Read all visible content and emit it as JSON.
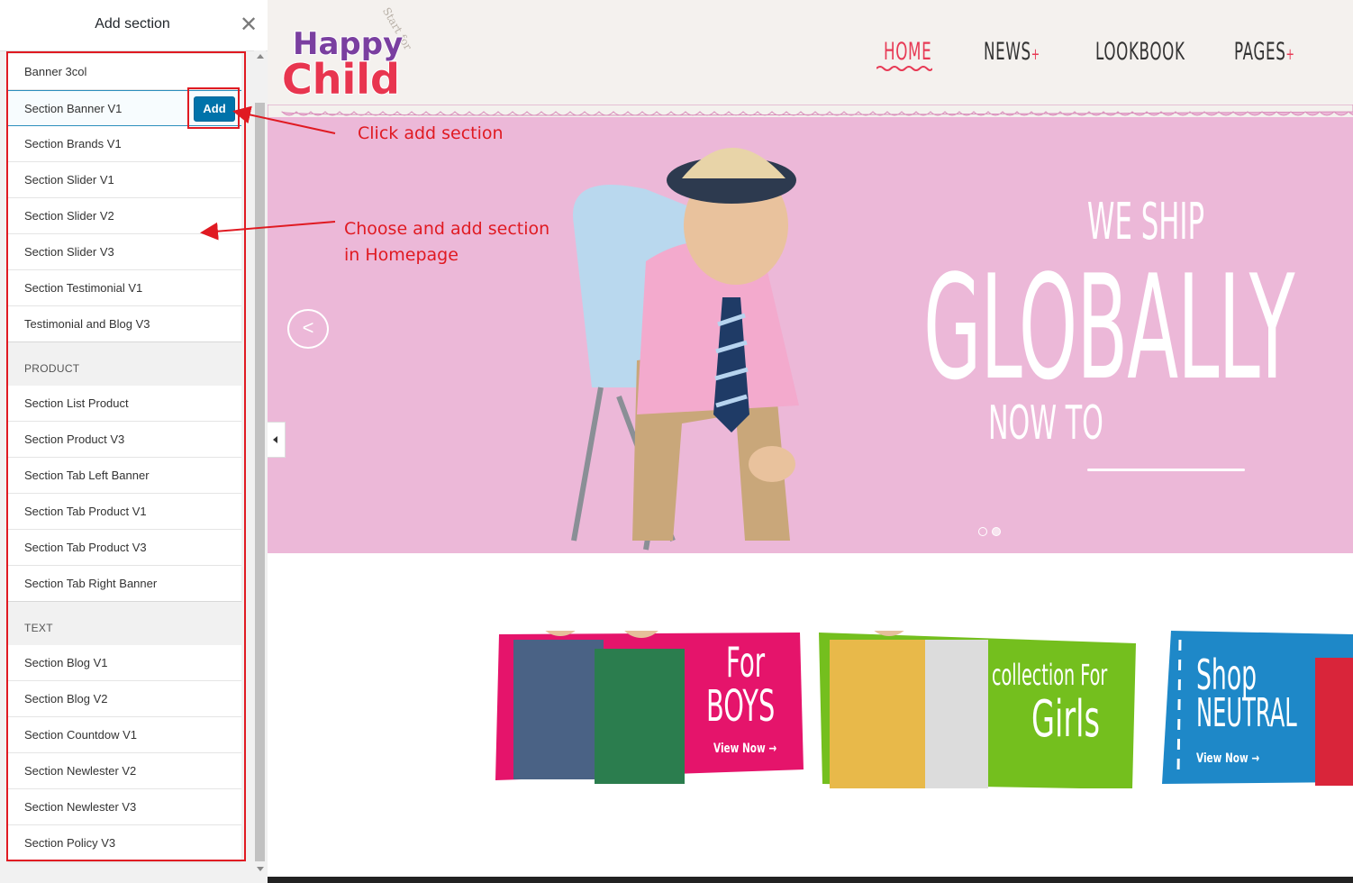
{
  "panel": {
    "title": "Add section",
    "close_icon": "close-icon",
    "add_label": "Add",
    "items_top": [
      "Banner 3col",
      "Section Banner V1",
      "Section Brands V1",
      "Section Slider V1",
      "Section Slider V2",
      "Section Slider V3",
      "Section Testimonial V1",
      "Testimonial and Blog V3"
    ],
    "group_product": "PRODUCT",
    "items_product": [
      "Section List Product",
      "Section Product V3",
      "Section Tab Left Banner",
      "Section Tab Product V1",
      "Section Tab Product V3",
      "Section Tab Right Banner"
    ],
    "group_text": "TEXT",
    "items_text": [
      "Section Blog V1",
      "Section Blog V2",
      "Section Countdow V1",
      "Section Newlester V2",
      "Section Newlester V3",
      "Section Policy V3"
    ]
  },
  "site": {
    "logo": {
      "line1": "Happy",
      "line2": "Child",
      "tagline": "Start for"
    },
    "nav": {
      "home": "HOME",
      "news": "NEWS",
      "lookbook": "LOOKBOOK",
      "pages": "PAGES",
      "plus": "+"
    },
    "banner": {
      "line1": "WE SHIP",
      "line2": "GLOBALLY",
      "line3": "NOW TO",
      "prev": "<",
      "bg": "#ecb8d8"
    },
    "categories": [
      {
        "line1": "For",
        "line2": "BOYS",
        "cta": "View Now",
        "color": "#e5146b"
      },
      {
        "line1": "collection For",
        "line2": "Girls",
        "cta": "",
        "color": "#74bf1e"
      },
      {
        "line1": "Shop",
        "line2": "NEUTRAL",
        "cta": "View Now",
        "color": "#1e88c8"
      }
    ]
  },
  "annotations": {
    "click_add": "Click add section",
    "choose_line1": "Choose and add section",
    "choose_line2": "in Homepage",
    "color": "#e01a22"
  }
}
